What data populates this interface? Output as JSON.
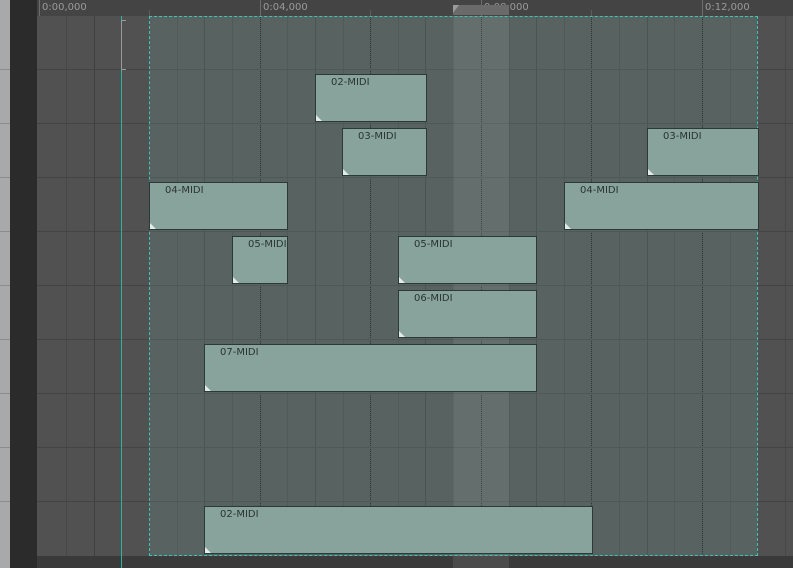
{
  "ruler": {
    "marks": [
      {
        "label": "0:00,000"
      },
      {
        "label": "0:04,000"
      },
      {
        "label": "0:08,000"
      },
      {
        "label": "0:12,000"
      }
    ]
  },
  "clips": [
    {
      "label": "02-MIDI"
    },
    {
      "label": "03-MIDI"
    },
    {
      "label": "03-MIDI"
    },
    {
      "label": "04-MIDI"
    },
    {
      "label": "04-MIDI"
    },
    {
      "label": "05-MIDI"
    },
    {
      "label": "05-MIDI"
    },
    {
      "label": "06-MIDI"
    },
    {
      "label": "07-MIDI"
    },
    {
      "label": "02-MIDI"
    }
  ],
  "colors": {
    "clip_fill": "#88a39b",
    "selection_border": "#3cc4b4",
    "cursor": "#2db3a6",
    "grid": "#515151"
  }
}
